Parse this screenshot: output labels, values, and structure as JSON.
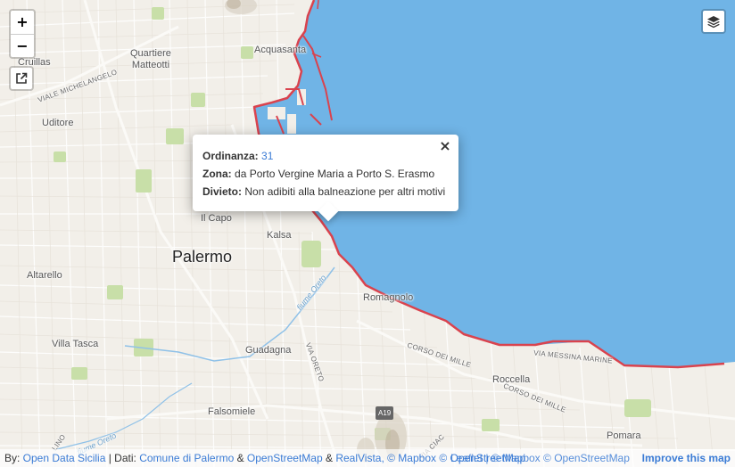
{
  "map": {
    "labels": {
      "quartiere_matteotti": "Quartiere\nMatteotti",
      "cruillas": "Cruillas",
      "acquasanta": "Acquasanta",
      "viale_michelangelo": "VIALE MICHELANGELO",
      "uditore": "Uditore",
      "il_capo": "Il Capo",
      "kalsa": "Kalsa",
      "palermo": "Palermo",
      "altarello": "Altarello",
      "romagnolo": "Romagnolo",
      "fiume_oreto": "fiume Oreto",
      "fiume_oreto2": "fiume Oreto",
      "villa_tasca": "Villa Tasca",
      "guadagna": "Guadagna",
      "via_oreto": "VIA ORETO",
      "corso_dei_mille": "CORSO DEI MILLE",
      "corso_dei_mille2": "CORSO DEI MILLE",
      "via_messina_marine": "VIA MESSINA MARINE",
      "roccella": "Roccella",
      "falsomiele": "Falsomiele",
      "a19": "A19",
      "pomara": "Pomara",
      "lino": "LINO",
      "via_ciaculli": "VIA CIAC"
    }
  },
  "controls": {
    "zoom_in": "+",
    "zoom_out": "−"
  },
  "popup": {
    "ordinanza_label": "Ordinanza:",
    "ordinanza_value": "31",
    "zona_label": "Zona:",
    "zona_value": "da Porto Vergine Maria a Porto S. Erasmo",
    "divieto_label": "Divieto:",
    "divieto_value": "Non adibiti alla balneazione per altri motivi",
    "close": "×"
  },
  "attribution": {
    "by": "By: ",
    "open_data": "Open Data Sicilia",
    "sep1": " | Dati: ",
    "comune": "Comune di Palermo",
    "amp1": " & ",
    "osm": "OpenStreetMap",
    "amp2": " & ",
    "realvista": "RealVista",
    "mapbox": ", © Mapbox © OpenStreetMap",
    "overlap": "Leaflet | © Mapbox © OpenStreetMap",
    "improve": "Improve this map"
  },
  "colors": {
    "sea": "#70b4e6",
    "land": "#f2efe9",
    "coast_line": "#d9434e",
    "park": "#c8dfa8",
    "link": "#3a7bd5"
  }
}
